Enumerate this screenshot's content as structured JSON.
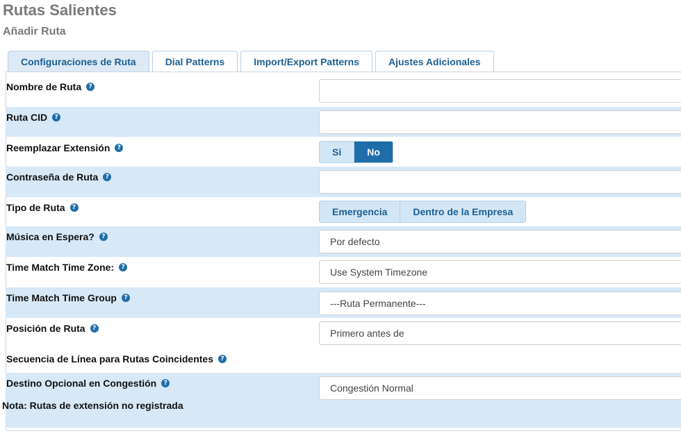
{
  "page": {
    "title": "Rutas Salientes",
    "subtitle": "Añadir Ruta"
  },
  "tabs": [
    {
      "label": "Configuraciones de Ruta",
      "active": true
    },
    {
      "label": "Dial Patterns",
      "active": false
    },
    {
      "label": "Import/Export Patterns",
      "active": false
    },
    {
      "label": "Ajustes Adicionales",
      "active": false
    }
  ],
  "form": {
    "route_name": {
      "label": "Nombre de Ruta",
      "value": ""
    },
    "route_cid": {
      "label": "Ruta CID",
      "value": ""
    },
    "override_extension": {
      "label": "Reemplazar Extensión",
      "options": [
        "Si",
        "No"
      ],
      "selected": "No"
    },
    "route_password": {
      "label": "Contraseña de Ruta",
      "value": ""
    },
    "route_type": {
      "label": "Tipo de Ruta",
      "options": [
        "Emergencia",
        "Dentro de la Empresa"
      ]
    },
    "music_on_hold": {
      "label": "Música en Espera?",
      "value": "Por defecto"
    },
    "time_zone": {
      "label": "Time Match Time Zone:",
      "value": "Use System Timezone"
    },
    "time_group": {
      "label": "Time Match Time Group",
      "value": "---Ruta Permanente---"
    },
    "route_position": {
      "label": "Posición de Ruta",
      "value": "Primero antes de"
    },
    "trunk_sequence": {
      "label": "Secuencia de Línea para Rutas Coincidentes"
    },
    "congestion_destination": {
      "label": "Destino Opcional en Congestión",
      "value": "Congestión Normal"
    }
  },
  "note": "Nota: Rutas de extensión no registrada",
  "help_glyph": "?",
  "colors": {
    "accent": "#1f6ea9",
    "row_alt": "#d7e8f6",
    "tab_text": "#1b5f93",
    "title_gray": "#7a7a7a"
  }
}
